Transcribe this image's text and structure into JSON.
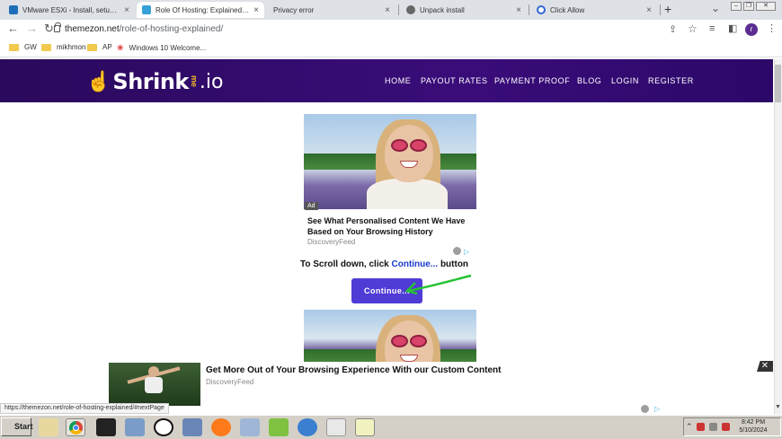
{
  "browser": {
    "tabs": [
      {
        "label": "VMware ESXi - Install, setup drive"
      },
      {
        "label": "Role Of Hosting: Explained – The"
      },
      {
        "label": "Privacy error"
      },
      {
        "label": "Unpack install"
      },
      {
        "label": "Click Allow"
      }
    ],
    "new_tab": "+",
    "close": "×",
    "tab_search": "⌄",
    "window_min": "–",
    "window_max": "❐",
    "window_close": "✕",
    "url_domain": "themezon.net",
    "url_path": "/role-of-hosting-explained/",
    "profile_initial": "r",
    "bookmarks": [
      {
        "label": "GW"
      },
      {
        "label": "mikhmon"
      },
      {
        "label": "AP"
      },
      {
        "label": "Windows 10 Welcome..."
      }
    ],
    "status_url": "https://themezon.net/role-of-hosting-explained/#nextPage"
  },
  "site": {
    "logo_word": "Shrink",
    "logo_me": "me",
    "logo_io": ".io",
    "nav": [
      "HOME",
      "PAYOUT RATES",
      "PAYMENT PROOF",
      "BLOG",
      "LOGIN",
      "REGISTER"
    ]
  },
  "ad": {
    "badge": "Ad",
    "title": "See What Personalised Content We Have Based on Your Browsing History",
    "source": "DiscoveryFeed"
  },
  "hint": {
    "prefix": "To Scroll down, click ",
    "highlight": "Continue...",
    "suffix": " button"
  },
  "continue_label": "Continue...",
  "bottom_ad": {
    "title": "Get More Out of Your Browsing Experience With our Custom Content",
    "source": "DiscoveryFeed",
    "close": "✕"
  },
  "taskbar": {
    "start": "Start",
    "time": "8:42 PM",
    "date": "5/10/2024"
  }
}
